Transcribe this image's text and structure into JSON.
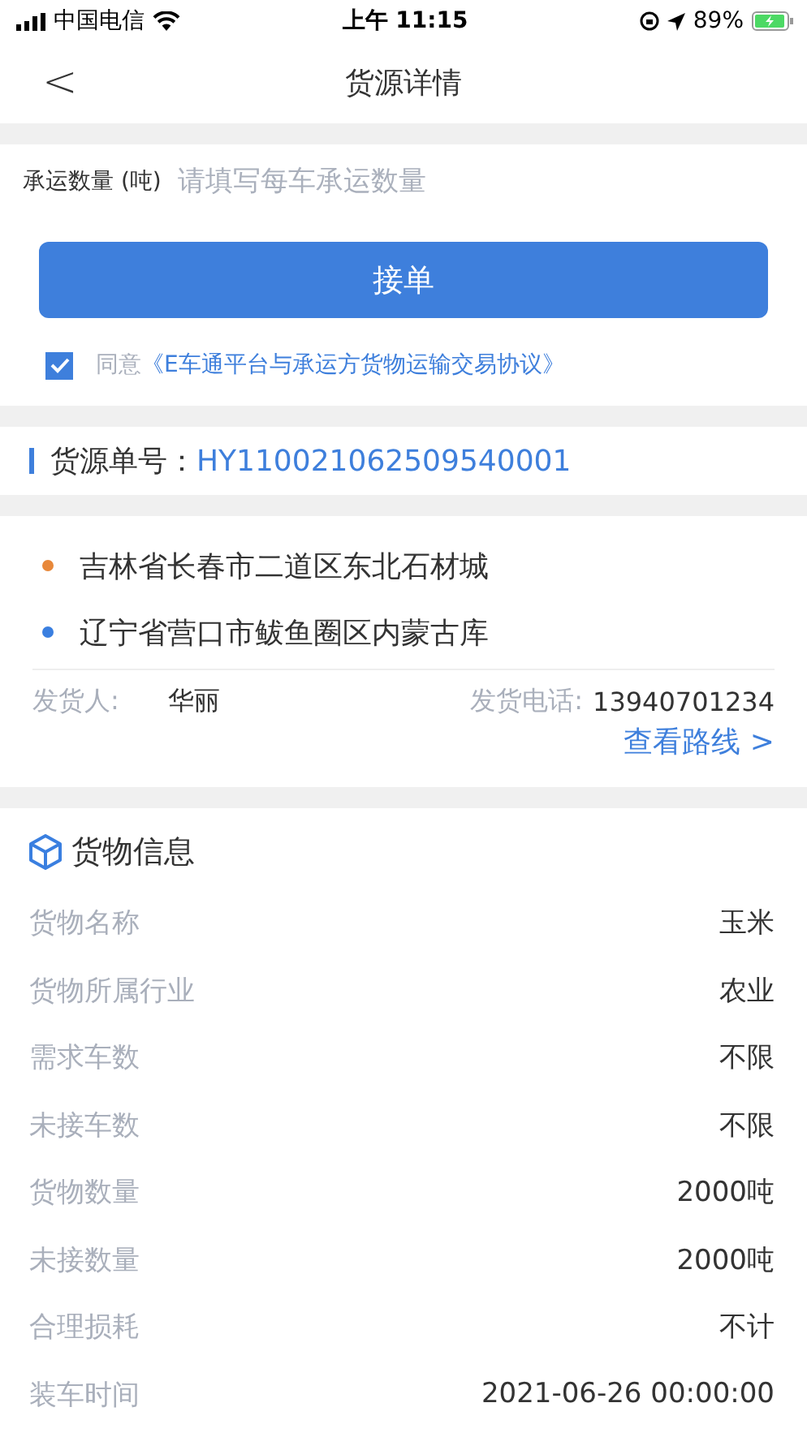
{
  "status_bar": {
    "carrier": "中国电信",
    "time": "上午 11:15",
    "battery": "89%"
  },
  "nav": {
    "back": "<",
    "title": "货源详情"
  },
  "form": {
    "label": "承运数量 (吨)",
    "placeholder": "请填写每车承运数量",
    "button": "接单",
    "agree": {
      "checked": true,
      "prefix": "同意",
      "link": "《E车通平台与承运方货物运输交易协议》"
    }
  },
  "order": {
    "label": "货源单号：",
    "number": "HY110021062509540001"
  },
  "route": {
    "stops": [
      {
        "address": "吉林省长春市二道区东北石材城",
        "color": "#e8883a"
      },
      {
        "address": "辽宁省营口市鲅鱼圈区内蒙古库",
        "color": "#3a7fe0"
      }
    ],
    "shipper_label": "发货人:",
    "shipper": "华丽",
    "phone_label": "发货电话:",
    "phone": "13940701234",
    "route_link": "查看路线 >"
  },
  "goods": {
    "title": "货物信息",
    "rows": [
      {
        "label": "货物名称",
        "value": "玉米"
      },
      {
        "label": "货物所属行业",
        "value": "农业"
      },
      {
        "label": "需求车数",
        "value": "不限"
      },
      {
        "label": "未接车数",
        "value": "不限"
      },
      {
        "label": "货物数量",
        "value": "2000吨"
      },
      {
        "label": "未接数量",
        "value": "2000吨"
      },
      {
        "label": "合理损耗",
        "value": "不计"
      },
      {
        "label": "装车时间",
        "value": "2021-06-26 00:00:00"
      }
    ]
  }
}
